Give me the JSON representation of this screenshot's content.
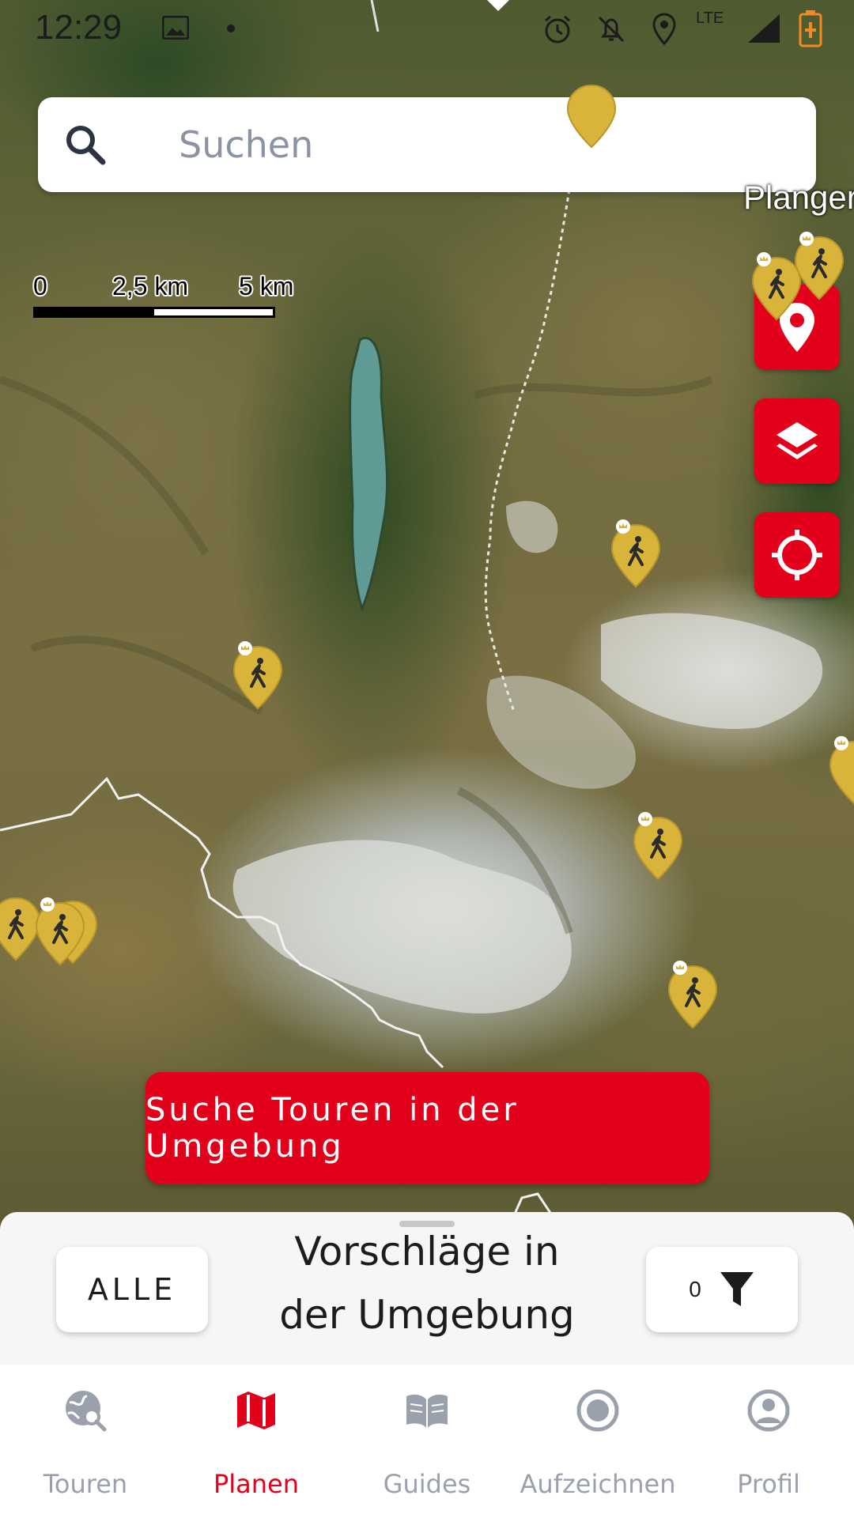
{
  "status_bar": {
    "time": "12:29",
    "network": "LTE",
    "icons": [
      "image-icon",
      "dot-icon",
      "alarm-icon",
      "bell-off-icon",
      "location-icon",
      "signal-icon",
      "battery-charging-icon"
    ]
  },
  "search": {
    "placeholder": "Suchen"
  },
  "map": {
    "scale": {
      "labels": [
        "0",
        "2,5 km",
        "5 km"
      ]
    },
    "place_label": "Plangerο",
    "marker_color": "#d8b43a",
    "controls": [
      "location-pin-icon",
      "layers-icon",
      "crosshair-icon"
    ]
  },
  "cta": {
    "label": "Suche Touren in der Umgebung"
  },
  "sheet": {
    "title": "Vorschläge in der Umgebung",
    "all_button": "ALLE",
    "filter_count": "0"
  },
  "nav": {
    "items": [
      {
        "label": "Touren",
        "icon": "globe-search-icon",
        "active": false
      },
      {
        "label": "Planen",
        "icon": "map-icon",
        "active": true
      },
      {
        "label": "Guides",
        "icon": "book-open-icon",
        "active": false
      },
      {
        "label": "Aufzeichnen",
        "icon": "record-icon",
        "active": false
      },
      {
        "label": "Profil",
        "icon": "user-circle-icon",
        "active": false
      }
    ]
  },
  "colors": {
    "accent": "#e2001a",
    "inactive": "#9aa1ad",
    "marker": "#d8b43a"
  }
}
